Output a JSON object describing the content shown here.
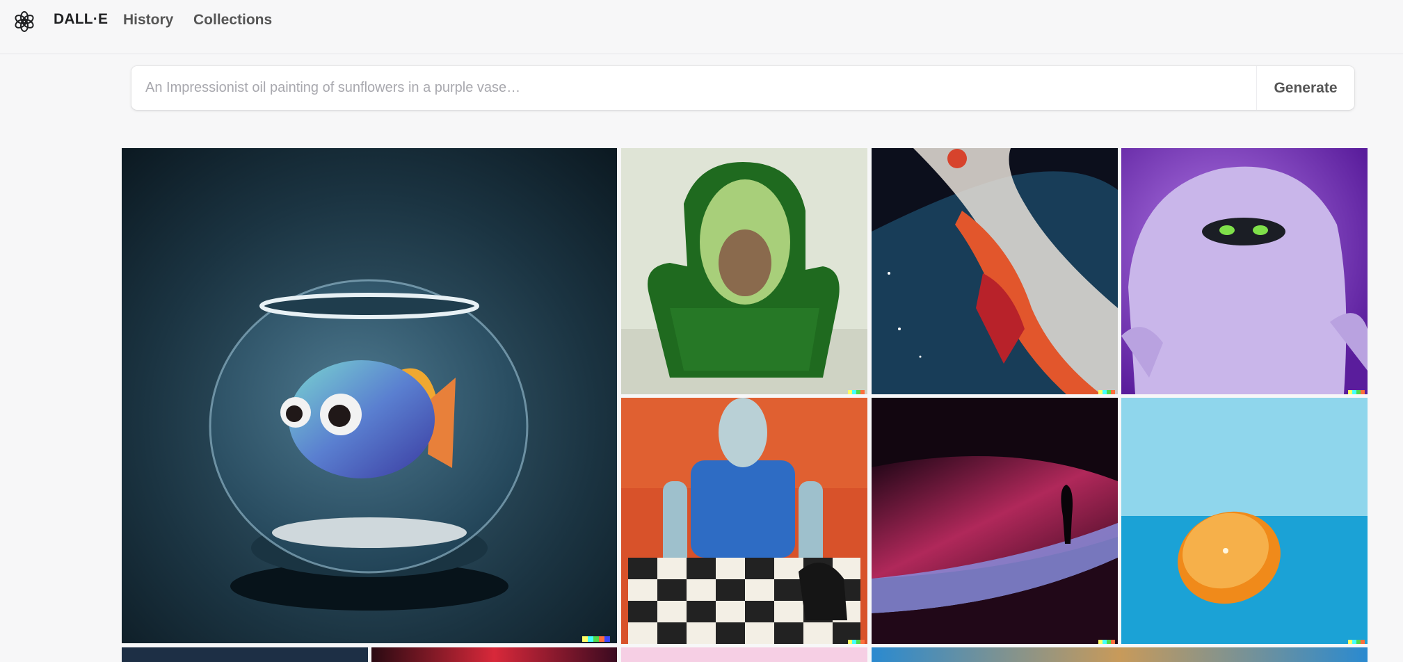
{
  "header": {
    "brand": "DALL·E",
    "nav": [
      "History",
      "Collections"
    ]
  },
  "prompt": {
    "placeholder": "An Impressionist oil painting of sunflowers in a purple vase…",
    "button_label": "Generate"
  },
  "gallery": {
    "tiles": [
      {
        "subject": "3D fish in a glass fishbowl"
      },
      {
        "subject": "avocado-shaped green velvet armchair"
      },
      {
        "subject": "cosmic basketball dunk oil painting"
      },
      {
        "subject": "fluffy purple monster"
      },
      {
        "subject": "robot playing chess painting"
      },
      {
        "subject": "person standing in pink light dune landscape"
      },
      {
        "subject": "orange half on blue background"
      }
    ]
  },
  "colors": {
    "background": "#f7f7f8",
    "text": "#202123",
    "signature": [
      "#ffff66",
      "#42ffff",
      "#51da4c",
      "#ff6e3c",
      "#3c46ff"
    ]
  }
}
